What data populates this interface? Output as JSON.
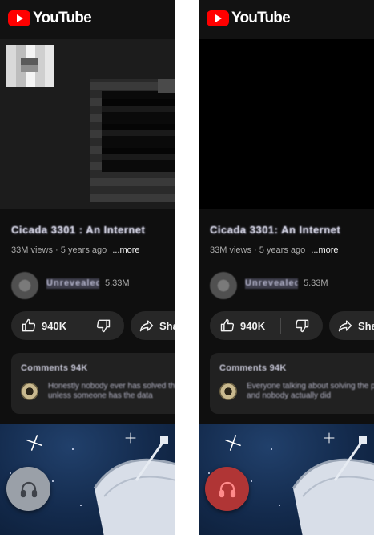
{
  "brand": {
    "wordmark": "YouTube",
    "accent": "#ff0000"
  },
  "panels": [
    {
      "video_title": "Cicada 3301 : An Internet",
      "meta": {
        "views": "33M views",
        "age": "5 years ago",
        "more": "...more"
      },
      "channel": {
        "name": "Unrevealed",
        "subscribers": "5.33M"
      },
      "actions": {
        "likes": "940K",
        "share": "Share"
      },
      "comments": {
        "header": "Comments 94K",
        "preview": "Honestly nobody ever has solved this thing for real",
        "preview2": "unless someone has the data"
      },
      "headphone_button": {
        "color": "#9aa0a8",
        "state": "inactive"
      }
    },
    {
      "video_title": "Cicada 3301: An Internet",
      "meta": {
        "views": "33M views",
        "age": "5 years ago",
        "more": "...more"
      },
      "channel": {
        "name": "Unrevealed",
        "subscribers": "5.33M"
      },
      "actions": {
        "likes": "940K",
        "share": "Share"
      },
      "comments": {
        "header": "Comments 94K",
        "preview": "Everyone talking about solving the puzzle",
        "preview2": "and nobody actually did"
      },
      "headphone_button": {
        "color": "#b03535",
        "state": "active"
      }
    }
  ]
}
